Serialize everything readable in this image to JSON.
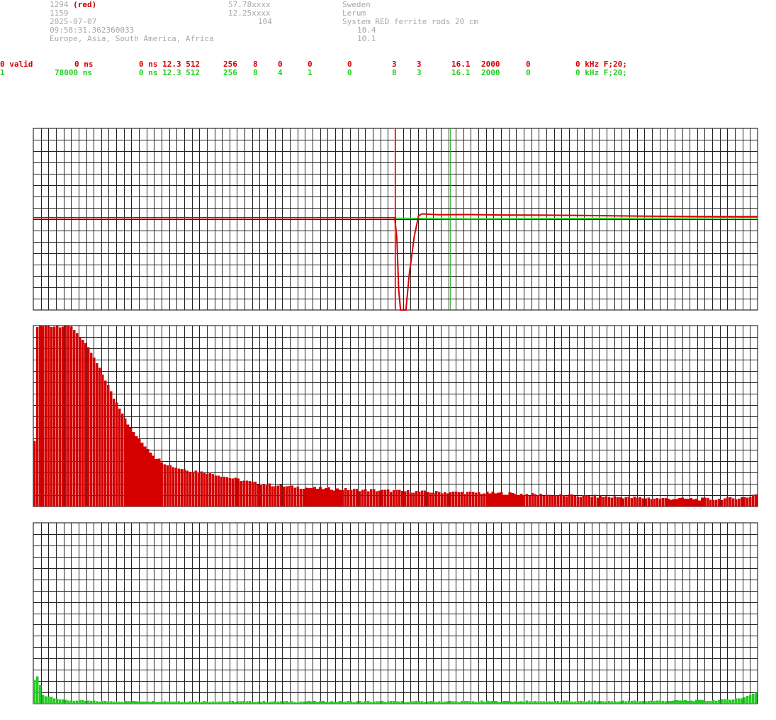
{
  "header": {
    "station_id": "1294",
    "station_tag": "(red)",
    "line2": "1159",
    "date": "2025-07-07",
    "time": "09:58:31.362360033",
    "regions": "Europe, Asia, South America, Africa",
    "lat": "57.78xxxx",
    "lon": "12.25xxxx",
    "alt": "104",
    "country": "Sweden",
    "city": "Lerum",
    "system": "System RED ferrite rods 20 cm",
    "val1": "10.4",
    "val2": "10.1"
  },
  "channels": [
    {
      "color": "#d40000",
      "cells": [
        "0 valid",
        "0 ns",
        "0 ns 12.3 512",
        "256",
        "8",
        "0",
        "0",
        "0",
        "3",
        "3",
        "16.1",
        "2000",
        "0",
        "0 kHz F;20;"
      ]
    },
    {
      "color": "#22cc22",
      "cells": [
        "1",
        "78000 ns",
        "0 ns 12.3 512",
        "256",
        "8",
        "4",
        "1",
        "0",
        "8",
        "3",
        "16.1",
        "2000",
        "0",
        "0 kHz F;20;"
      ]
    }
  ],
  "chart_data": [
    {
      "type": "line",
      "title": "",
      "grid": true,
      "ylim": [
        -1,
        1
      ],
      "marker_lines": [
        {
          "color": "#ff9090",
          "x": 0.499
        },
        {
          "color": "#22aa22",
          "x": 0.576
        }
      ],
      "series": [
        {
          "color": "#d40000",
          "points": [
            [
              0,
              0
            ],
            [
              0.499,
              0
            ],
            [
              0.502,
              -0.22
            ],
            [
              0.5045,
              -0.78
            ],
            [
              0.507,
              -1
            ],
            [
              0.5145,
              -1
            ],
            [
              0.519,
              -0.62
            ],
            [
              0.526,
              -0.2
            ],
            [
              0.532,
              0.04
            ],
            [
              0.537,
              0.07
            ],
            [
              0.56,
              0.055
            ],
            [
              0.6,
              0.058
            ],
            [
              0.65,
              0.05
            ],
            [
              0.7,
              0.048
            ],
            [
              0.75,
              0.043
            ],
            [
              0.8,
              0.035
            ],
            [
              0.85,
              0.03
            ],
            [
              0.9,
              0.025
            ],
            [
              0.95,
              0.02
            ],
            [
              1,
              0.02
            ]
          ]
        },
        {
          "color": "#22cc22",
          "points": [
            [
              0,
              0
            ],
            [
              0.499,
              0
            ],
            [
              0.5,
              -0.005
            ],
            [
              0.55,
              -0.01
            ],
            [
              0.6,
              -0.012
            ],
            [
              0.7,
              -0.01
            ],
            [
              0.8,
              -0.007
            ],
            [
              0.9,
              -0.004
            ],
            [
              1,
              0
            ]
          ]
        }
      ]
    },
    {
      "type": "bar",
      "title": "",
      "color": "#d40000",
      "ylim": [
        0,
        1
      ],
      "grid": true,
      "anchors": [
        [
          0,
          0.36
        ],
        [
          1,
          0.995
        ],
        [
          12,
          1
        ],
        [
          14,
          0.98
        ],
        [
          17,
          0.92
        ],
        [
          20,
          0.85
        ],
        [
          22,
          0.79
        ],
        [
          25,
          0.7
        ],
        [
          28,
          0.6
        ],
        [
          31,
          0.52
        ],
        [
          34,
          0.43
        ],
        [
          37,
          0.37
        ],
        [
          40,
          0.32
        ],
        [
          43,
          0.27
        ],
        [
          46,
          0.24
        ],
        [
          50,
          0.215
        ],
        [
          55,
          0.2
        ],
        [
          60,
          0.19
        ],
        [
          65,
          0.175
        ],
        [
          70,
          0.155
        ],
        [
          80,
          0.125
        ],
        [
          90,
          0.11
        ],
        [
          100,
          0.1
        ],
        [
          120,
          0.09
        ],
        [
          140,
          0.08
        ],
        [
          160,
          0.075
        ],
        [
          180,
          0.065
        ],
        [
          200,
          0.055
        ],
        [
          220,
          0.045
        ],
        [
          240,
          0.04
        ],
        [
          252,
          0.05
        ],
        [
          255,
          0.07
        ]
      ],
      "noise": 0.008
    },
    {
      "type": "bar",
      "title": "",
      "color": "#22cc22",
      "ylim": [
        0,
        1
      ],
      "grid": true,
      "anchors": [
        [
          0,
          0.13
        ],
        [
          1,
          0.15
        ],
        [
          2,
          0.1
        ],
        [
          3,
          0.05
        ],
        [
          5,
          0.04
        ],
        [
          8,
          0.03
        ],
        [
          10,
          0.02
        ],
        [
          20,
          0.014
        ],
        [
          100,
          0.012
        ],
        [
          200,
          0.014
        ],
        [
          240,
          0.018
        ],
        [
          250,
          0.03
        ],
        [
          253,
          0.05
        ],
        [
          255,
          0.06
        ]
      ],
      "noise": 0.004
    }
  ]
}
